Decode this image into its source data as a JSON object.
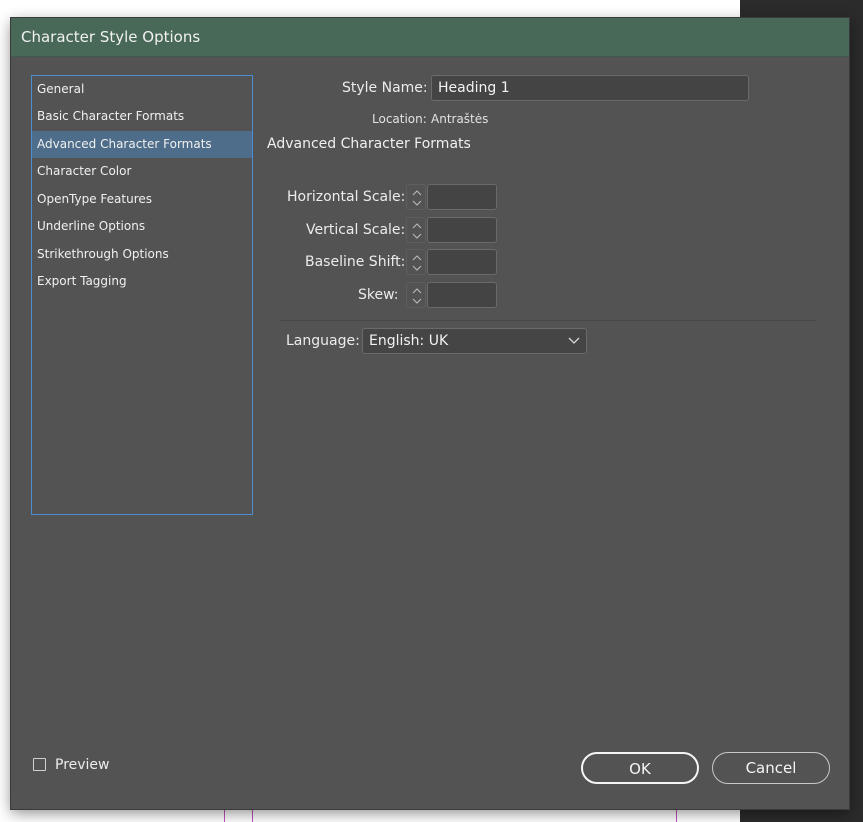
{
  "dialog": {
    "title": "Character Style Options"
  },
  "categories": [
    {
      "label": "General",
      "selected": false
    },
    {
      "label": "Basic Character Formats",
      "selected": false
    },
    {
      "label": "Advanced Character Formats",
      "selected": true
    },
    {
      "label": "Character Color",
      "selected": false
    },
    {
      "label": "OpenType Features",
      "selected": false
    },
    {
      "label": "Underline Options",
      "selected": false
    },
    {
      "label": "Strikethrough Options",
      "selected": false
    },
    {
      "label": "Export Tagging",
      "selected": false
    }
  ],
  "style": {
    "name_label": "Style Name:",
    "name_value": "Heading 1",
    "location_label": "Location:",
    "location_value": "Antraštės"
  },
  "section": {
    "title": "Advanced Character Formats"
  },
  "fields": {
    "horizontal_scale": {
      "label": "Horizontal Scale:",
      "value": ""
    },
    "vertical_scale": {
      "label": "Vertical Scale:",
      "value": ""
    },
    "baseline_shift": {
      "label": "Baseline Shift:",
      "value": ""
    },
    "skew": {
      "label": "Skew:",
      "value": ""
    }
  },
  "language": {
    "label": "Language:",
    "value": "English: UK"
  },
  "preview": {
    "label": "Preview",
    "checked": false
  },
  "buttons": {
    "ok": "OK",
    "cancel": "Cancel"
  },
  "colors": {
    "titlebar": "#486858",
    "dialog_bg": "#535353",
    "selection": "#4e6d8a",
    "list_border": "#4b8dd0"
  }
}
